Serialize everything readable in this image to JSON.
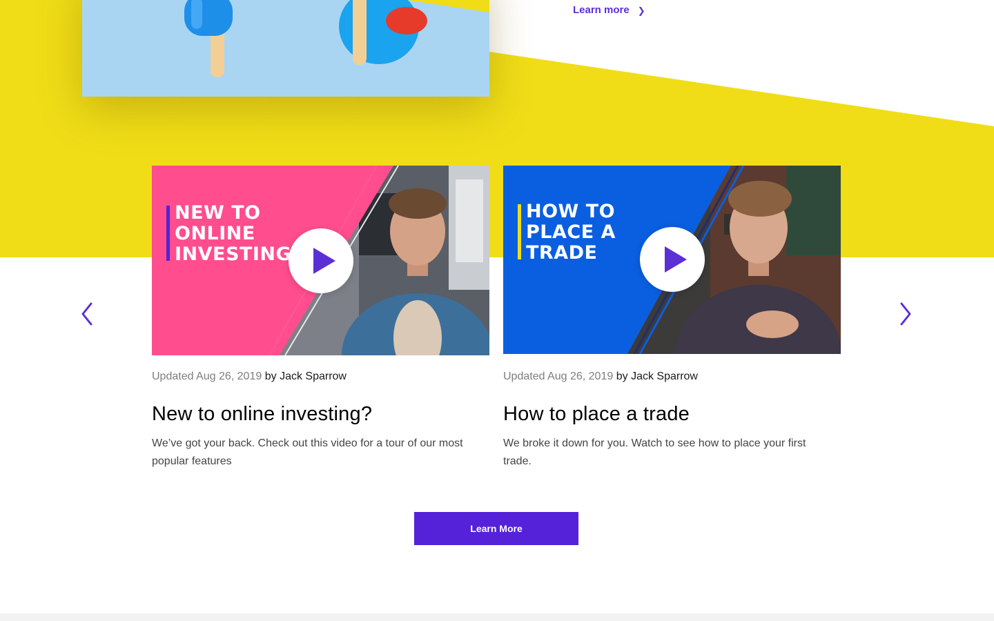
{
  "colors": {
    "yellow": "#f0dd17",
    "accent_purple": "#5522d9",
    "link_purple": "#5b2fd6",
    "thumb_pink": "#ff4d8d",
    "thumb_blue": "#0a5fe0"
  },
  "hero": {
    "learn_more_label": "Learn more",
    "chevron_icon": "chevron-right-icon"
  },
  "carousel": {
    "prev_icon": "chevron-left-icon",
    "next_icon": "chevron-right-icon",
    "cards": [
      {
        "thumb_title": "NEW TO\nONLINE\nINVESTING",
        "updated": "Updated Aug 26, 2019",
        "by": "by",
        "author": "Jack Sparrow",
        "title": "New to online investing?",
        "description": "We’ve got your back. Check out this video for a tour of our most popular features"
      },
      {
        "thumb_title": "HOW TO\nPLACE A\nTRADE",
        "updated": "Updated Aug 26, 2019",
        "by": "by",
        "author": "Jack Sparrow",
        "title": "How to place a trade",
        "description": "We broke it down for you. Watch to see how to place your first trade."
      }
    ]
  },
  "cta": {
    "label": "Learn More"
  }
}
